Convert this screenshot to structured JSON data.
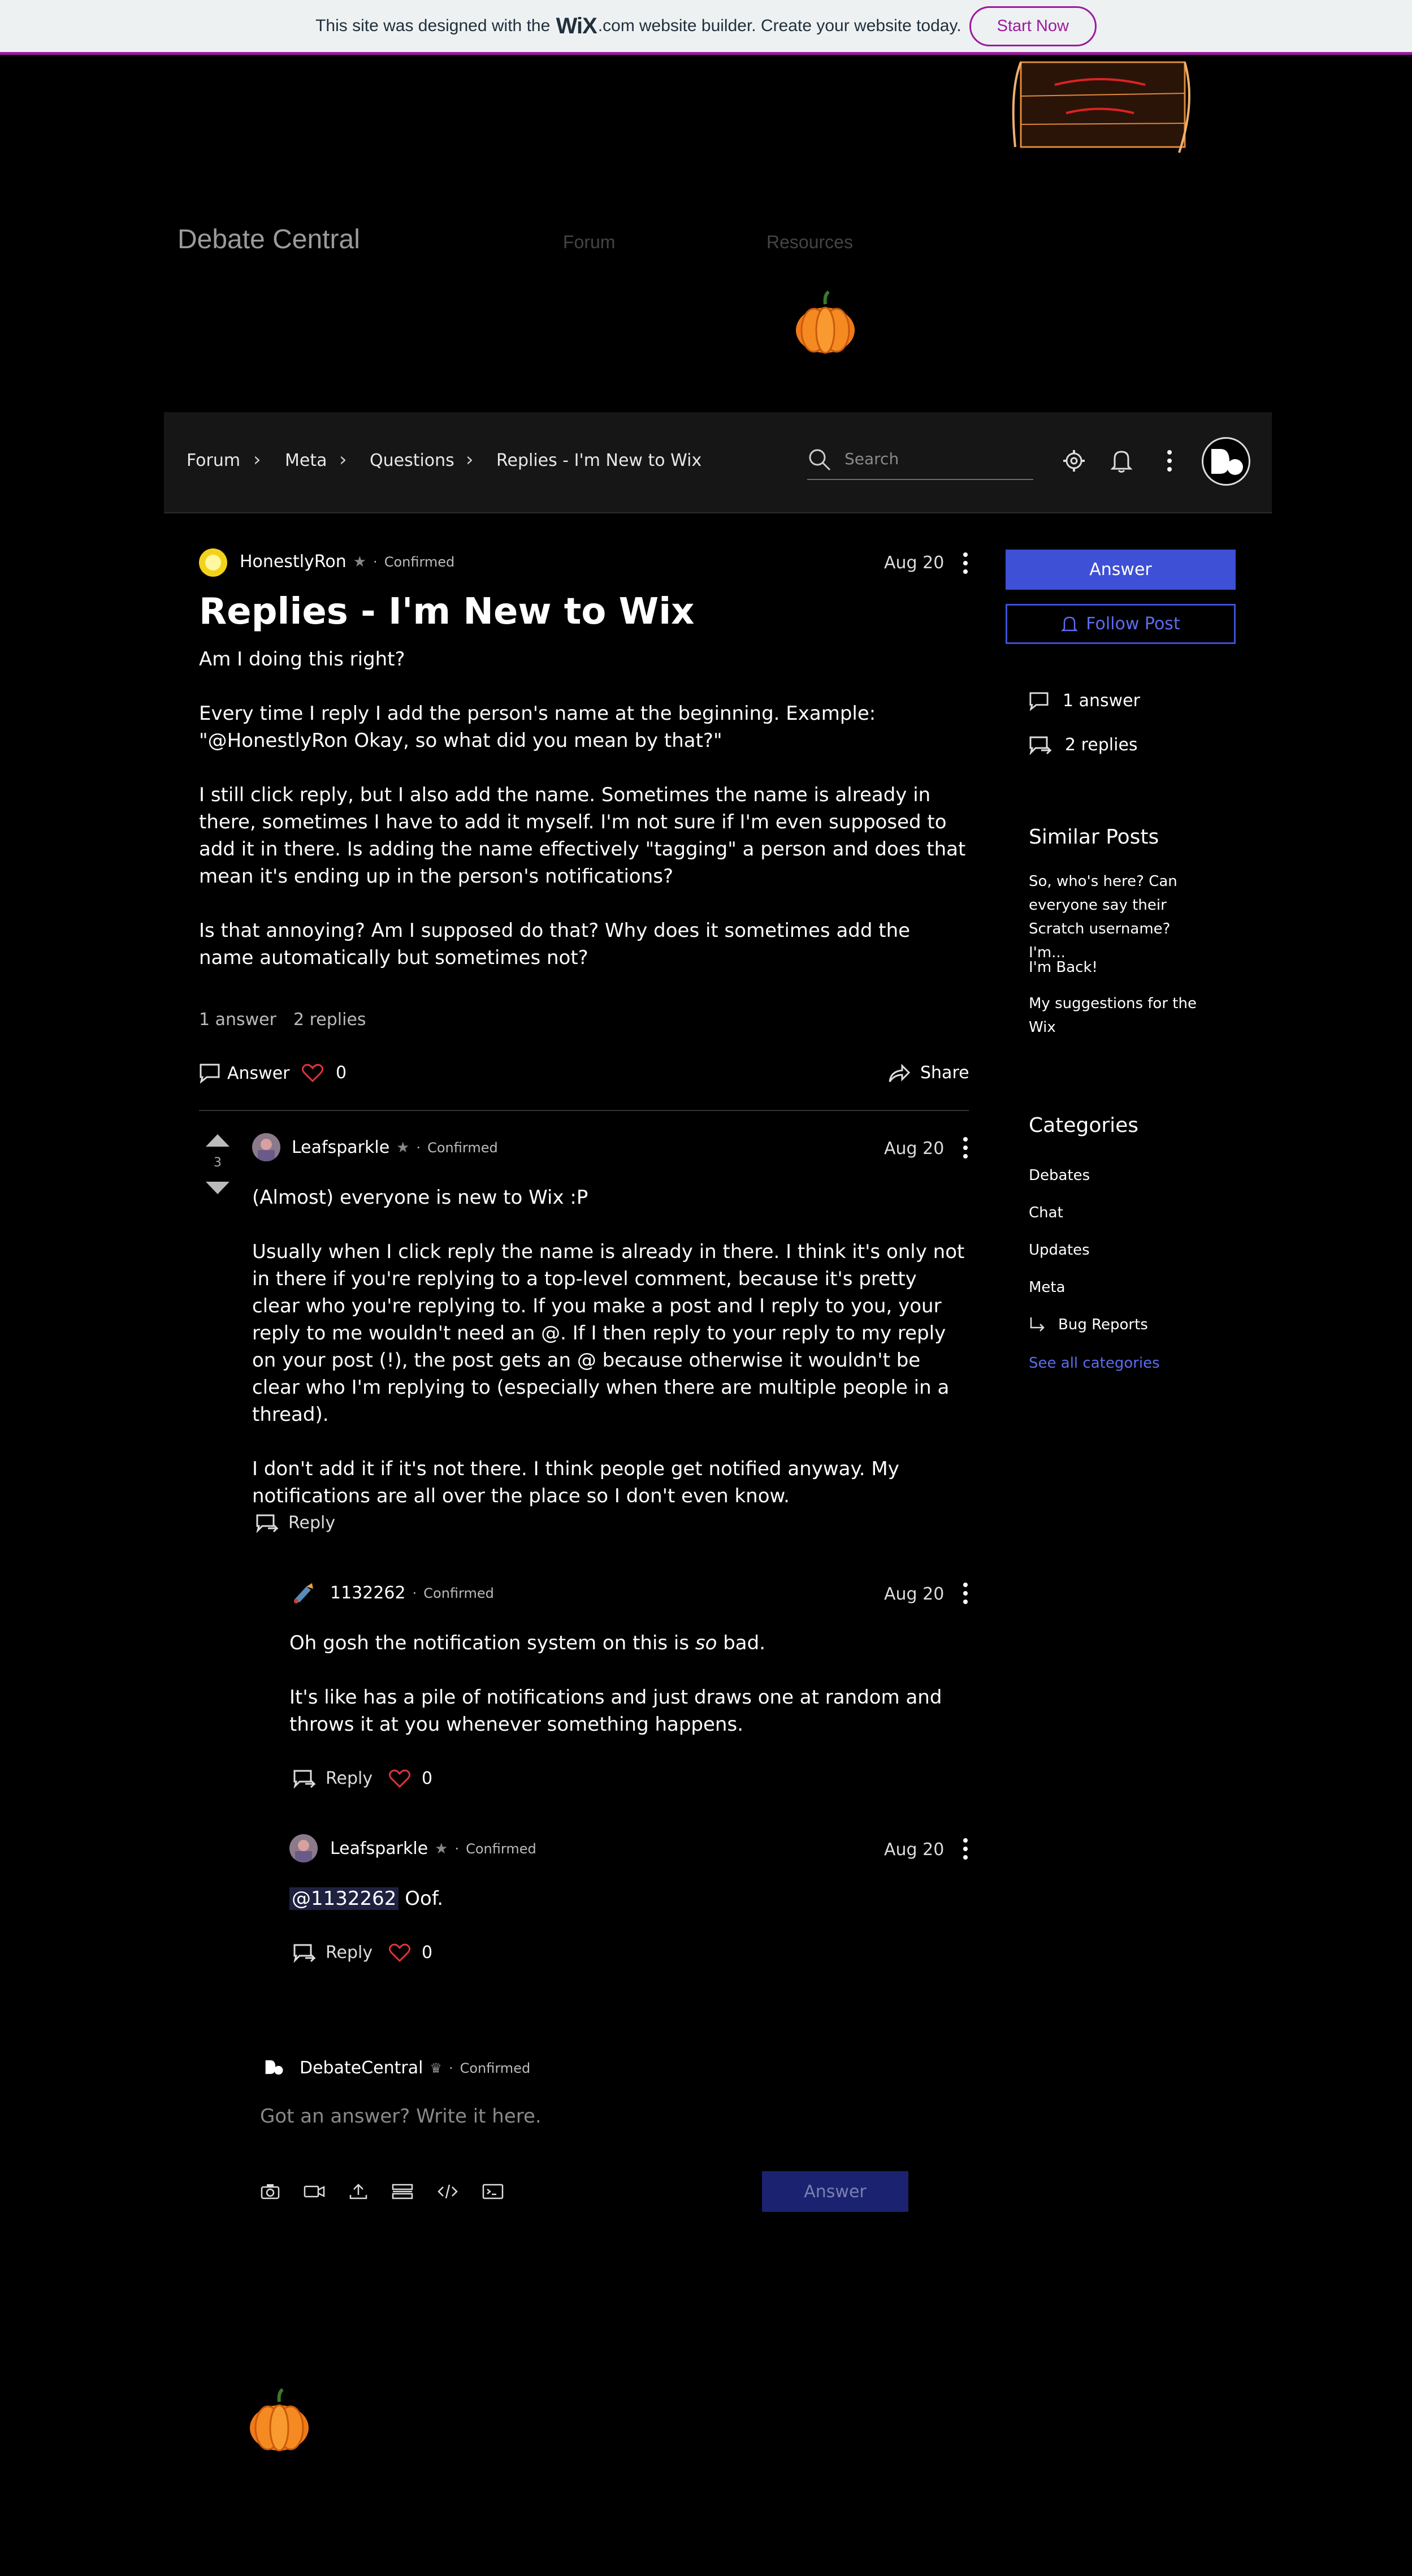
{
  "banner": {
    "text_before": "This site was designed with the",
    "logo_wix": "WiX",
    "logo_com": ".com",
    "text_after": "website builder. Create your website today.",
    "cta": "Start Now"
  },
  "site": {
    "title": "Debate Central",
    "nav": [
      "Forum",
      "Resources"
    ]
  },
  "breadcrumb": [
    "Forum",
    "Meta",
    "Questions",
    "Replies - I'm New to Wix"
  ],
  "search": {
    "placeholder": "Search"
  },
  "post": {
    "author": "HonestlyRon",
    "badge": "Confirmed",
    "date": "Aug 20",
    "title": "Replies - I'm New to Wix",
    "paragraphs": [
      "Am I doing this right?",
      "Every time I reply I add the person's name at the beginning. Example: \"@HonestlyRon Okay, so what did you mean by that?\"",
      "I still click reply, but I also add the name. Sometimes the name is already in there, sometimes I have to add it myself. I'm not sure if I'm even supposed to add it in there. Is adding the name effectively \"tagging\" a person and does that mean it's ending up in the person's notifications?",
      "Is that annoying? Am I supposed do that? Why does it sometimes add the name automatically but sometimes not?"
    ],
    "answer_count": "1 answer",
    "reply_count": "2 replies",
    "answer_label": "Answer",
    "likes": "0",
    "share_label": "Share"
  },
  "sidebar": {
    "answer_button": "Answer",
    "follow_button": "Follow Post",
    "stats": [
      "1 answer",
      "2 replies"
    ],
    "similar_heading": "Similar Posts",
    "similar_posts": [
      "So, who's here? Can everyone say their Scratch username? I'm...",
      "I'm Back!",
      "My suggestions for the Wix"
    ],
    "categories_heading": "Categories",
    "categories": [
      "Debates",
      "Chat",
      "Updates",
      "Meta",
      "Bug Reports"
    ],
    "see_all": "See all categories"
  },
  "answer": {
    "author": "Leafsparkle",
    "badge": "Confirmed",
    "date": "Aug 20",
    "votes": "3",
    "paragraphs": [
      "(Almost) everyone is new to Wix :P",
      "Usually when I click reply the name is already in there. I think it's only not in there if you're replying to a top-level comment, because it's pretty clear who you're replying to. If you make a post and I reply to you, your reply to me wouldn't need an @. If I then reply to your reply to my reply on your post (!), the post gets an @ because otherwise it wouldn't be clear who I'm replying to (especially when there are multiple people in a thread).",
      "I don't add it if it's not there. I think people get notified anyway. My notifications are all over the place so I don't even know."
    ],
    "reply_label": "Reply"
  },
  "replies": [
    {
      "author": "1132262",
      "badge": "Confirmed",
      "date": "Aug 20",
      "line1_before": "Oh gosh the notification system on this is ",
      "line1_em": "so",
      "line1_after": " bad.",
      "line2": "It's like has a pile of notifications and just draws one at random and throws it at you whenever something happens.",
      "reply_label": "Reply",
      "likes": "0"
    },
    {
      "author": "Leafsparkle",
      "badge": "Confirmed",
      "date": "Aug 20",
      "mention": "@1132262",
      "text": "Oof.",
      "reply_label": "Reply",
      "likes": "0"
    }
  ],
  "composer": {
    "author": "DebateCentral",
    "badge": "Confirmed",
    "placeholder": "Got an answer? Write it here.",
    "submit": "Answer"
  },
  "colors": {
    "accent": "#3e50d6",
    "banner_accent": "#9c1a9f",
    "like_heart": "#e0343c"
  }
}
